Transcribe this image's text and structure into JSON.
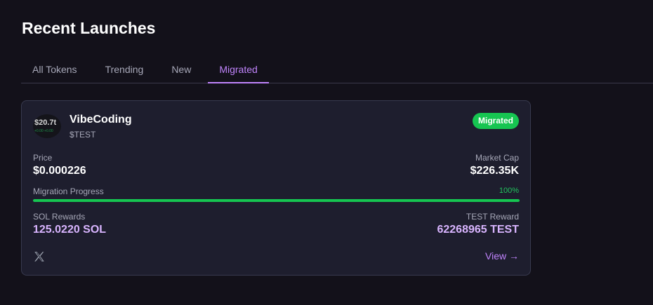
{
  "header": {
    "title": "Recent Launches"
  },
  "tabs": [
    {
      "label": "All Tokens"
    },
    {
      "label": "Trending"
    },
    {
      "label": "New"
    },
    {
      "label": "Migrated"
    }
  ],
  "active_tab": "Migrated",
  "card": {
    "avatar": {
      "price_text": "$20.7t",
      "sub_text": "+0.00 +0.00"
    },
    "name": "VibeCoding",
    "symbol": "$TEST",
    "status": "Migrated",
    "price": {
      "label": "Price",
      "value": "$0.000226"
    },
    "market_cap": {
      "label": "Market Cap",
      "value": "$226.35K"
    },
    "migration": {
      "label": "Migration Progress",
      "percent_text": "100%",
      "fraction": 1.0
    },
    "sol_rewards": {
      "label": "SOL Rewards",
      "value": "125.0220 SOL"
    },
    "token_reward": {
      "label": "TEST Reward",
      "value": "62268965 TEST"
    },
    "social_icon": "x-logo-icon",
    "view_label": "View →"
  },
  "colors": {
    "accent": "#c084fc",
    "success": "#16c551",
    "background": "#13111a",
    "card": "#1e1e2e"
  }
}
